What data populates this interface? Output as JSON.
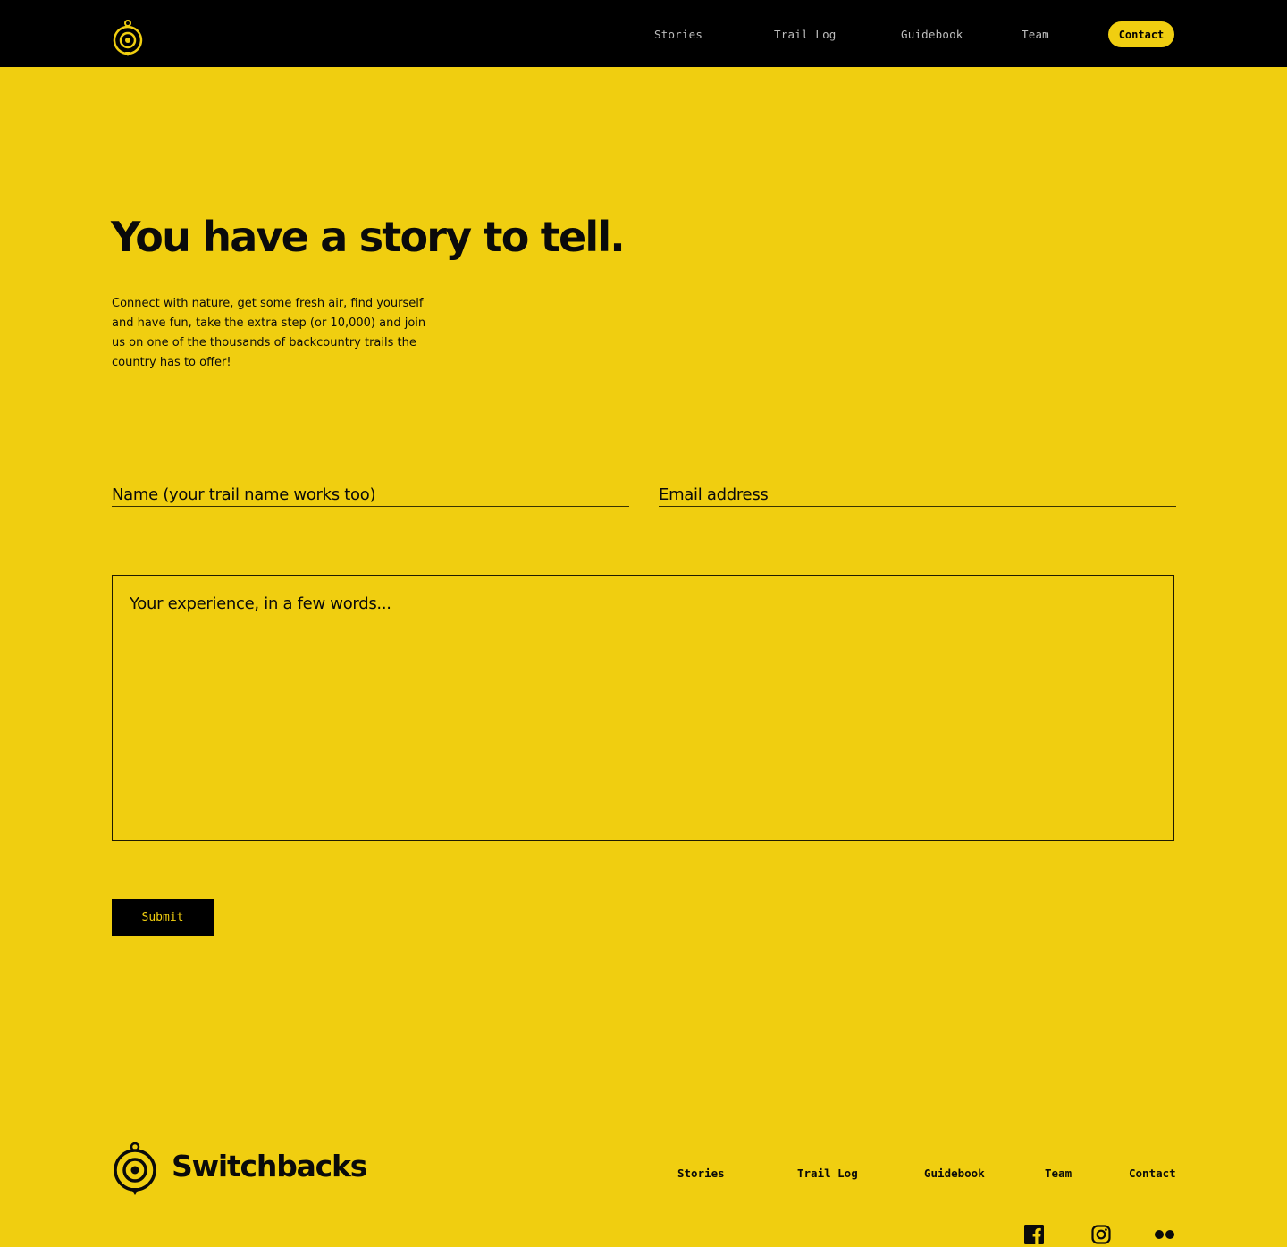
{
  "header": {
    "nav": [
      {
        "label": "Stories"
      },
      {
        "label": "Trail Log"
      },
      {
        "label": "Guidebook"
      },
      {
        "label": "Team"
      }
    ],
    "contact_label": "Contact",
    "logo_icon": "compass-pin-logo"
  },
  "hero": {
    "headline": "You have a story to tell.",
    "intro": "Connect with nature, get some fresh air, find yourself and have fun, take the extra step (or 10,000) and join us on one of the thousands of backcountry trails the country has to offer!"
  },
  "form": {
    "name_placeholder": "Name (your trail name works too)",
    "email_placeholder": "Email address",
    "message_placeholder": "Your experience, in a few words...",
    "submit_label": "Submit"
  },
  "footer": {
    "brand": "Switchbacks",
    "nav": [
      {
        "label": "Stories"
      },
      {
        "label": "Trail Log"
      },
      {
        "label": "Guidebook"
      },
      {
        "label": "Team"
      },
      {
        "label": "Contact"
      }
    ],
    "social": [
      {
        "icon": "facebook-icon"
      },
      {
        "icon": "instagram-icon"
      },
      {
        "icon": "flickr-icon"
      }
    ]
  },
  "colors": {
    "background": "#F0CE10",
    "header": "#000000",
    "text": "#0A0A0A"
  }
}
